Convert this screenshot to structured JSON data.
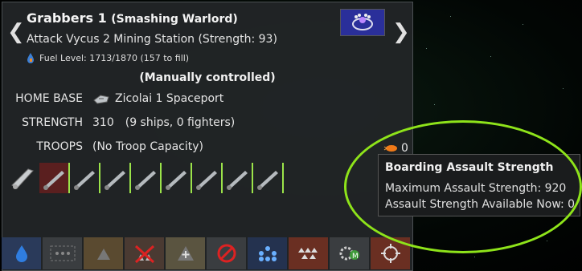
{
  "fleet": {
    "name": "Grabbers 1",
    "type": "(Smashing Warlord)",
    "order": "Attack Vycus 2 Mining Station (Strength: 93)",
    "fuel": "Fuel Level: 1713/1870 (157 to fill)",
    "control": "(Manually controlled)"
  },
  "stats": {
    "home_base_label": "HOME BASE",
    "home_base_value": "Zicolai 1 Spaceport",
    "strength_label": "STRENGTH",
    "strength_value": "310",
    "strength_detail": "(9 ships, 0 fighters)",
    "troops_label": "TROOPS",
    "troops_value": "(No Troop Capacity)",
    "boarding_value": "0"
  },
  "tooltip": {
    "title": "Boarding Assault Strength",
    "line1": "Maximum Assault Strength: 920",
    "line2": "Assault Strength Available Now: 0"
  },
  "toolbar_icons": [
    "fuel-drop-icon",
    "formation-icon",
    "escort-icon",
    "no-attack-icon",
    "add-icon",
    "prohibit-icon",
    "dots-icon",
    "fighters-icon",
    "gear-auto-icon",
    "target-icon"
  ],
  "colors": {
    "accent": "#8ee31a",
    "selected_ship": "#5a1f1f"
  }
}
